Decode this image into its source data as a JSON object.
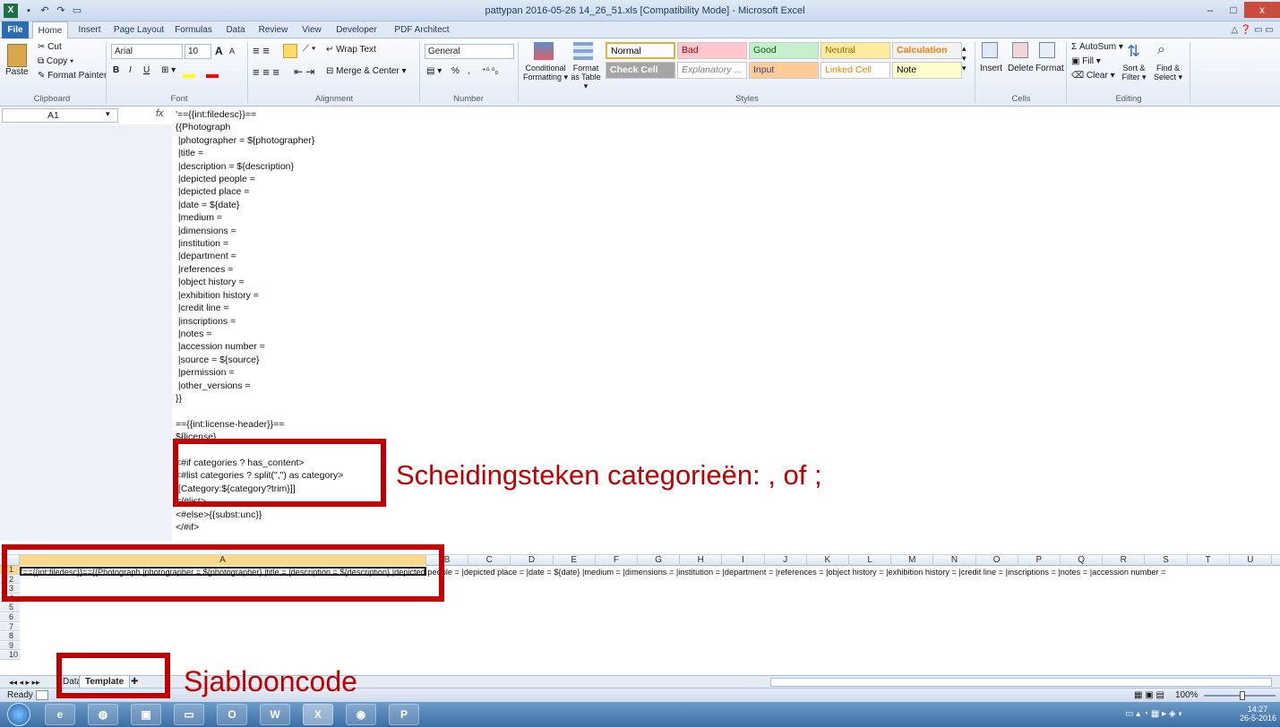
{
  "window": {
    "title": "pattypan 2016-05-26 14_26_51.xls  [Compatibility Mode]  -  Microsoft Excel",
    "logo": "X",
    "min": "–",
    "max": "□",
    "close": "x"
  },
  "tabs": [
    "File",
    "Home",
    "Insert",
    "Page Layout",
    "Formulas",
    "Data",
    "Review",
    "View",
    "Developer",
    "PDF Architect"
  ],
  "ribbon": {
    "clipboard": {
      "paste": "Paste",
      "cut": "Cut",
      "copy": "Copy ▾",
      "format_painter": "Format Painter",
      "label": "Clipboard"
    },
    "font": {
      "name": "Arial",
      "size": "10",
      "bold": "B",
      "italic": "I",
      "underline": "U",
      "grow": "A",
      "shrink": "A",
      "label": "Font"
    },
    "alignment": {
      "wrap": "Wrap Text",
      "merge": "Merge & Center ▾",
      "label": "Alignment"
    },
    "number": {
      "format": "General",
      "pct": "%",
      "comma": ",",
      "label": "Number"
    },
    "styles": {
      "conditional": "Conditional Formatting ▾",
      "format_table": "Format as Table ▾",
      "cells": [
        {
          "label": "Normal",
          "bg": "#ffffff",
          "color": "#000000"
        },
        {
          "label": "Bad",
          "bg": "#ffc7ce",
          "color": "#9c0006"
        },
        {
          "label": "Good",
          "bg": "#c6efce",
          "color": "#006100"
        },
        {
          "label": "Neutral",
          "bg": "#ffeb9c",
          "color": "#9c6500"
        },
        {
          "label": "Calculation",
          "bg": "#f2f2f2",
          "color": "#fa7d00"
        },
        {
          "label": "Check Cell",
          "bg": "#a5a5a5",
          "color": "#ffffff"
        },
        {
          "label": "Explanatory ...",
          "bg": "#ffffff",
          "color": "#7f7f7f"
        },
        {
          "label": "Input",
          "bg": "#ffcc99",
          "color": "#3f3f76"
        },
        {
          "label": "Linked Cell",
          "bg": "#ffffff",
          "color": "#fa7d00"
        },
        {
          "label": "Note",
          "bg": "#ffffcc",
          "color": "#000000"
        }
      ],
      "label": "Styles"
    },
    "cells": {
      "insert": "Insert",
      "delete": "Delete",
      "format": "Format",
      "label": "Cells"
    },
    "editing": {
      "autosum": "Σ AutoSum ▾",
      "fill": "Fill ▾",
      "clear": "Clear ▾",
      "sort": "Sort & Filter ▾",
      "find": "Find & Select ▾",
      "label": "Editing"
    }
  },
  "formula_bar": {
    "name_box": "A1",
    "fx": "fx",
    "content": "'=={{int:filedesc}}==\n{{Photograph\n |photographer = ${photographer}\n |title =\n |description = ${description}\n |depicted people =\n |depicted place =\n |date = ${date}\n |medium =\n |dimensions =\n |institution =\n |department =\n |references =\n |object history =\n |exhibition history =\n |credit line =\n |inscriptions =\n |notes =\n |accession number =\n |source = ${source}\n |permission =\n |other_versions =\n}}\n\n=={{int:license-header}}==\n${license}\n\n<#if categories ? has_content>\n<#list categories ? split(\",\") as category>\n[[Category:${category?trim}]]\n</#list>\n<#else>{{subst:unc}}\n</#if>"
  },
  "grid": {
    "columns": [
      "A",
      "B",
      "C",
      "D",
      "E",
      "F",
      "G",
      "H",
      "I",
      "J",
      "K",
      "L",
      "M",
      "N",
      "O",
      "P",
      "Q",
      "R",
      "S",
      "T",
      "U"
    ],
    "rows": [
      "1",
      "2",
      "3",
      "4",
      "5",
      "6",
      "7",
      "8",
      "9",
      "10"
    ],
    "row1_text": "'=={{int:filedesc}}=={{Photograph |photographer = ${photographer} |title =  |description = ${description} |depicted people =  |depicted place =  |date = ${date} |medium =  |dimensions =  |institution =  |department =  |references =  |object history =  |exhibition history =  |credit line =  |inscriptions =  |notes =  |accession number ="
  },
  "sheet_tabs": [
    "Data",
    "Template"
  ],
  "status": {
    "ready": "Ready",
    "zoom": "100%"
  },
  "taskbar": {
    "time": "14:27",
    "date": "26-5-2016"
  },
  "annotations": {
    "separator_note": "Scheidingsteken categorieën: , of ;",
    "template_note": "Sjablooncode"
  }
}
